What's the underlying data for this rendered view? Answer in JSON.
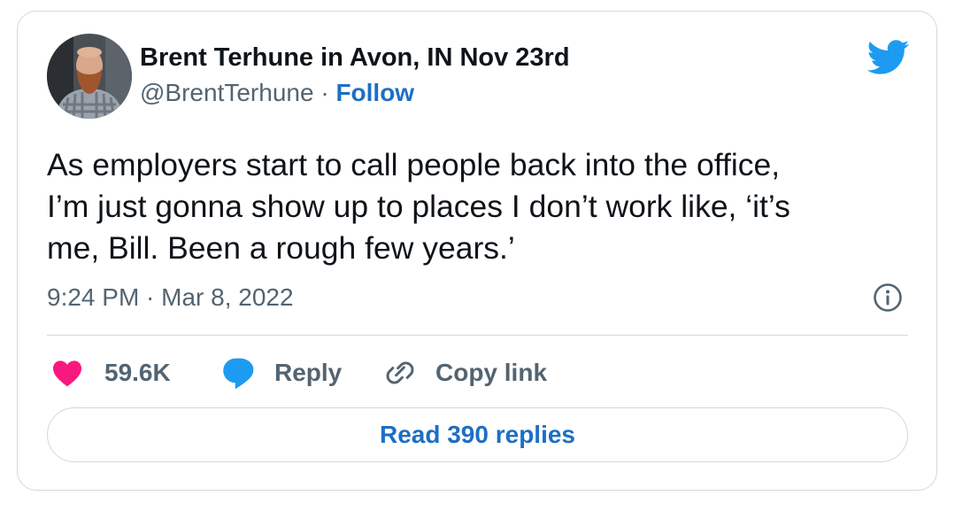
{
  "tweet": {
    "author": {
      "name": "Brent Terhune in Avon, IN Nov 23rd",
      "handle": "@BrentTerhune",
      "separator": " · ",
      "follow_label": "Follow",
      "avatar_icon": "profile-photo"
    },
    "logo_icon": "twitter-bird-icon",
    "text": "As employers start to call people back into the office,\nI’m just gonna show up to places I don’t work like, ‘it’s\nme, Bill. Been a rough few years.’",
    "timestamp": "9:24 PM · Mar 8, 2022",
    "info_icon": "info-icon",
    "actions": {
      "likes": "59.6K",
      "reply_label": "Reply",
      "copy_link_label": "Copy link"
    },
    "read_replies_label": "Read 390 replies"
  },
  "colors": {
    "text_primary": "#0f1419",
    "text_secondary": "#536471",
    "link_blue": "#1d6fc4",
    "twitter_blue": "#1d9bf0",
    "heart_pink": "#f91880",
    "border": "#cfd9de"
  }
}
